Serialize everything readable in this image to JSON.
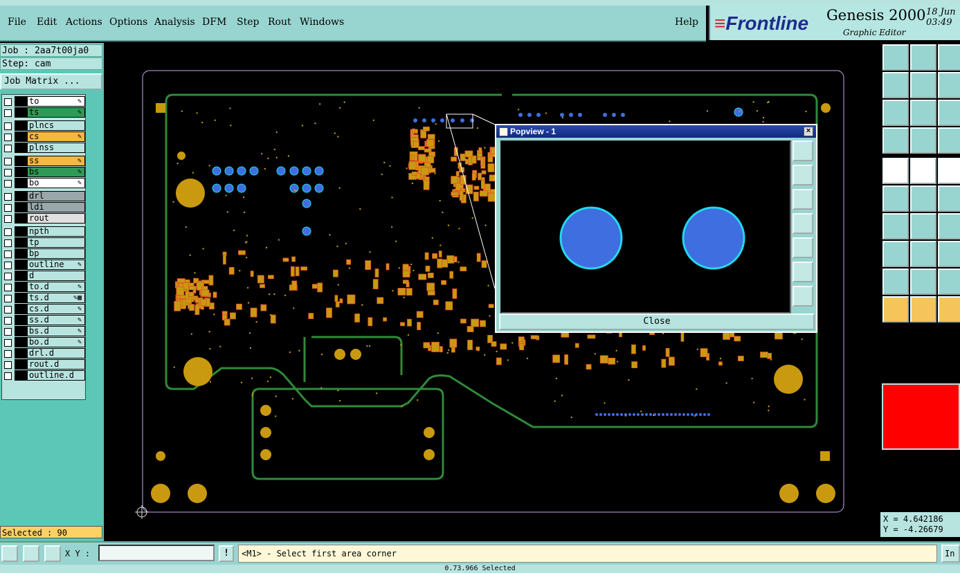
{
  "menu": {
    "items": [
      {
        "label": "File"
      },
      {
        "label": "Edit"
      },
      {
        "label": "Actions"
      },
      {
        "label": "Options"
      },
      {
        "label": "Analysis"
      },
      {
        "label": "DFM"
      },
      {
        "label": "Step"
      },
      {
        "label": "Rout"
      },
      {
        "label": "Windows"
      }
    ],
    "help": "Help"
  },
  "brand": {
    "logo": "Frontline",
    "title": "Genesis 2000",
    "subtitle": "Graphic Editor",
    "date_line1": "18 Jun",
    "date_line2": "03:49"
  },
  "job": {
    "job_line": "Job : 2aa7t00ja0",
    "step_line": "Step: cam",
    "matrix_button": "Job Matrix ..."
  },
  "layers": [
    {
      "name": "to",
      "color": "#ffffff",
      "mark": "✎"
    },
    {
      "name": "ts",
      "color": "#2e9a55",
      "mark": "✎"
    },
    {
      "name": "plncs",
      "color": "#b8e4e0",
      "mark": ""
    },
    {
      "name": "cs",
      "color": "#f5b840",
      "mark": "✎"
    },
    {
      "name": "plnss",
      "color": "#b8e4e0",
      "mark": ""
    },
    {
      "name": "ss",
      "color": "#f5b840",
      "mark": "✎"
    },
    {
      "name": "bs",
      "color": "#2e9a55",
      "mark": "✎"
    },
    {
      "name": "bo",
      "color": "#ffffff",
      "mark": "✎"
    },
    {
      "name": "drl",
      "color": "#9aa7aa",
      "mark": ""
    },
    {
      "name": "ldi",
      "color": "#9aa7aa",
      "mark": ""
    },
    {
      "name": "rout",
      "color": "#e0e0e0",
      "mark": ""
    },
    {
      "name": "npth",
      "color": "#b8e4e0",
      "mark": ""
    },
    {
      "name": "tp",
      "color": "#b8e4e0",
      "mark": ""
    },
    {
      "name": "bp",
      "color": "#b8e4e0",
      "mark": ""
    },
    {
      "name": "outline",
      "color": "#b8e4e0",
      "mark": "✎"
    },
    {
      "name": "d",
      "color": "#b8e4e0",
      "mark": ""
    },
    {
      "name": "to.d",
      "color": "#b8e4e0",
      "mark": "✎"
    },
    {
      "name": "ts.d",
      "color": "#b8e4e0",
      "mark": "✎▦"
    },
    {
      "name": "cs.d",
      "color": "#b8e4e0",
      "mark": "✎"
    },
    {
      "name": "ss.d",
      "color": "#b8e4e0",
      "mark": "✎"
    },
    {
      "name": "bs.d",
      "color": "#b8e4e0",
      "mark": "✎"
    },
    {
      "name": "bo.d",
      "color": "#b8e4e0",
      "mark": "✎"
    },
    {
      "name": "drl.d",
      "color": "#b8e4e0",
      "mark": ""
    },
    {
      "name": "rout.d",
      "color": "#b8e4e0",
      "mark": ""
    },
    {
      "name": "outline.d",
      "color": "#b8e4e0",
      "mark": ""
    }
  ],
  "selected": "Selected : 90",
  "popview": {
    "title": "Popview - 1",
    "close_label": "Close"
  },
  "coords": {
    "x": "X = 4.642186",
    "y": "Y = -4.26679"
  },
  "bottom": {
    "xy_label": "X Y :",
    "xy_value": "",
    "excl": "!",
    "prompt": "<M1> - Select first area corner",
    "in_button": "In"
  },
  "status_line": "0.73.966 Selected"
}
